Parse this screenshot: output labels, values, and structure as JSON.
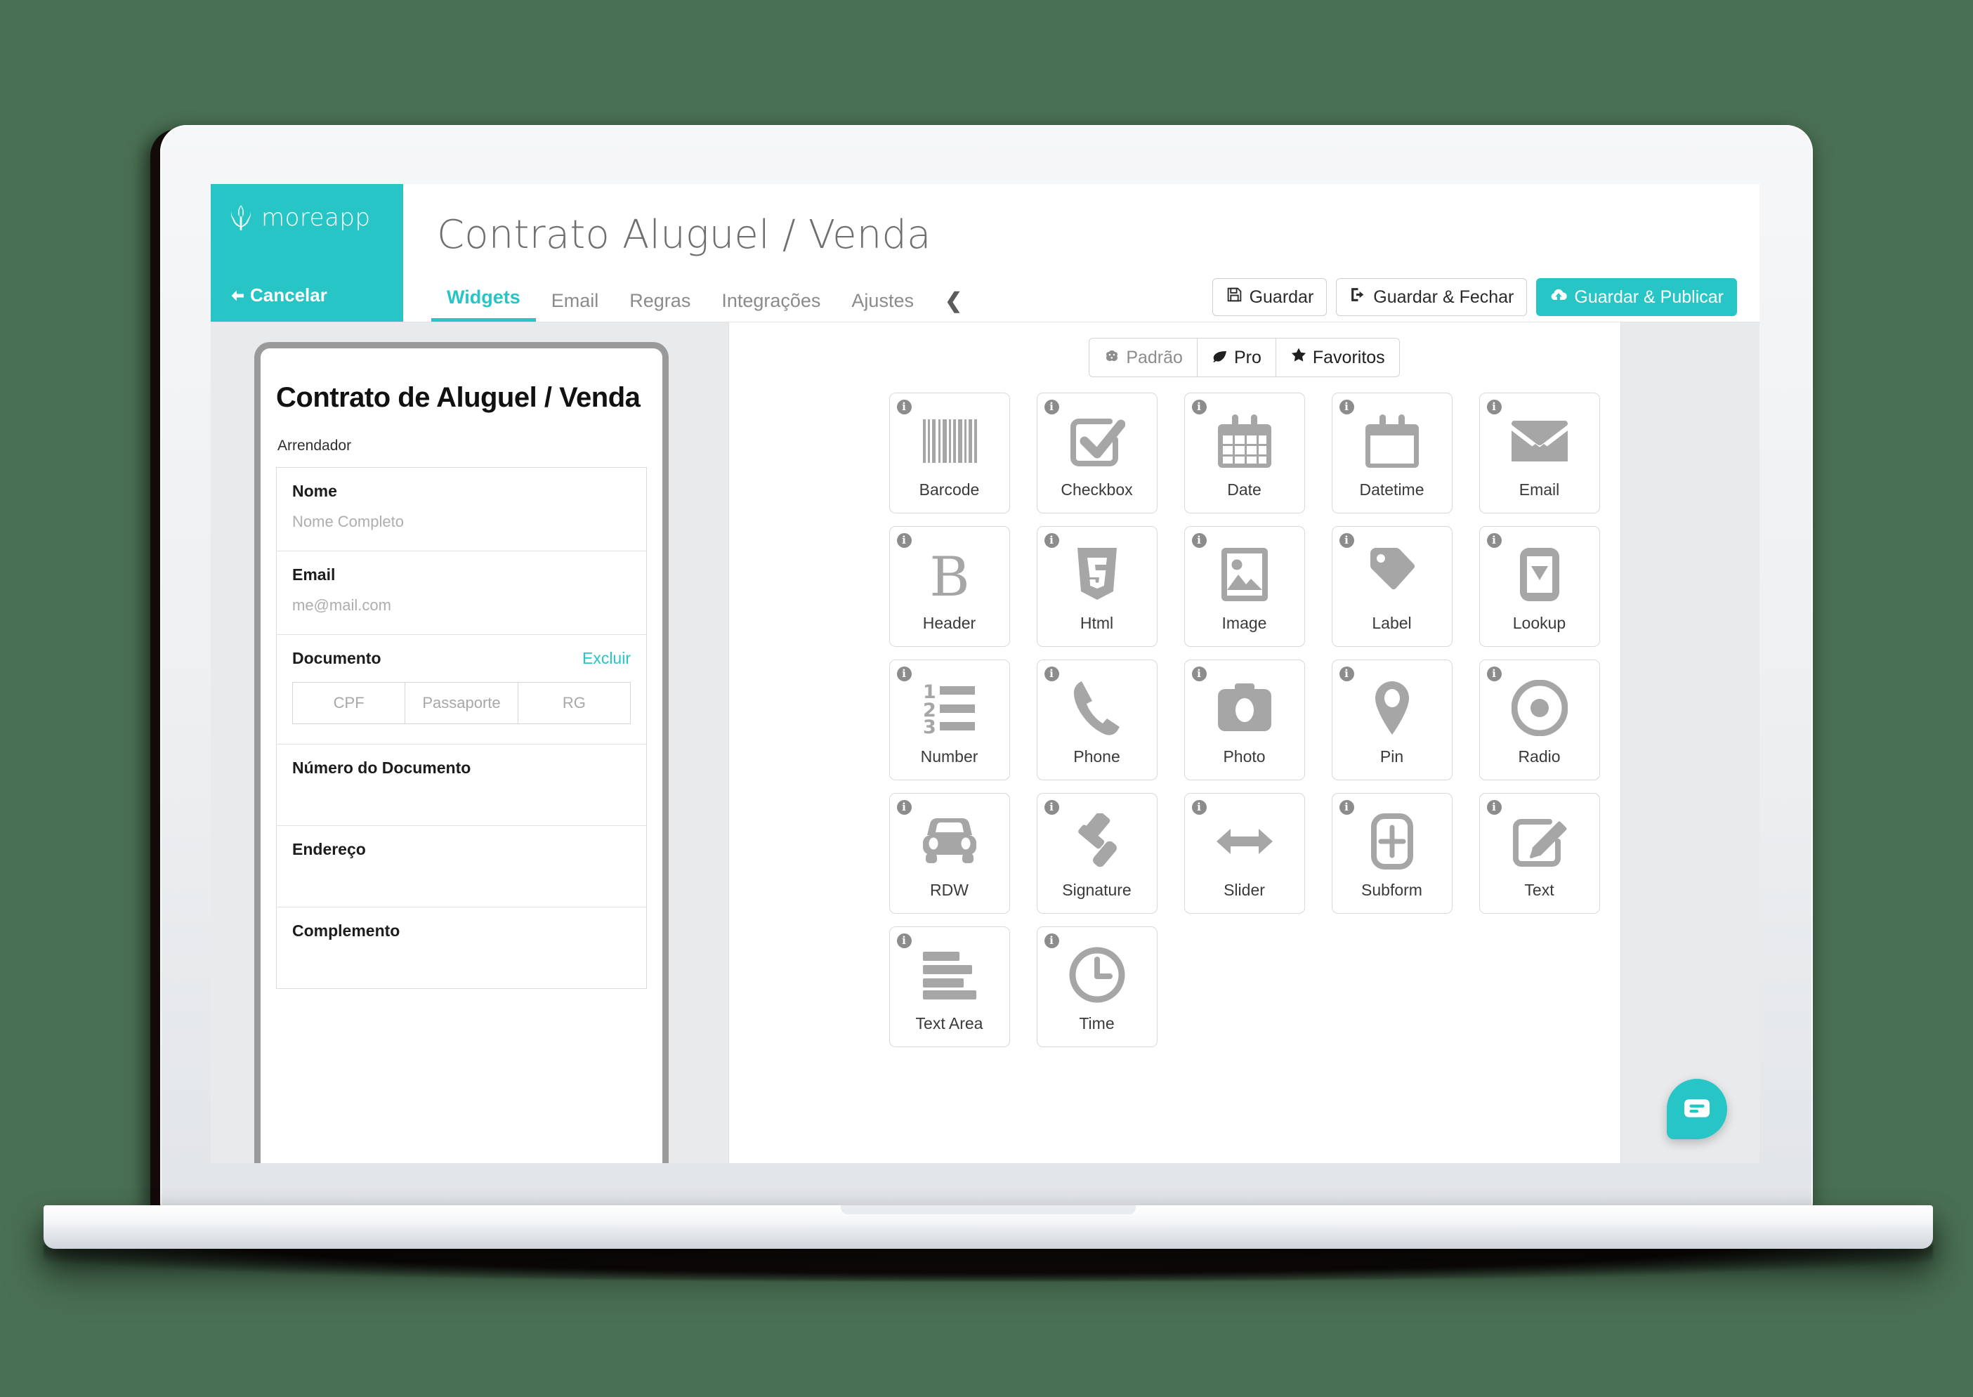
{
  "app": {
    "brand_name": "moreapp",
    "brand_icon": "leaf-logo-icon",
    "cancel_label": "Cancelar",
    "page_title": "Contrato Aluguel / Venda",
    "accent_color": "#27c5c6"
  },
  "tabs": [
    {
      "label": "Widgets",
      "active": true
    },
    {
      "label": "Email",
      "active": false
    },
    {
      "label": "Regras",
      "active": false
    },
    {
      "label": "Integrações",
      "active": false
    },
    {
      "label": "Ajustes",
      "active": false
    }
  ],
  "tab_collapse_icon": "chevron-left-icon",
  "actions": [
    {
      "label": "Guardar",
      "icon": "floppy-save-icon",
      "primary": false
    },
    {
      "label": "Guardar & Fechar",
      "icon": "sign-out-icon",
      "primary": false
    },
    {
      "label": "Guardar & Publicar",
      "icon": "cloud-upload-icon",
      "primary": true
    }
  ],
  "preview": {
    "form_title": "Contrato de Aluguel / Venda",
    "section_label": "Arrendador",
    "fields": [
      {
        "label": "Nome",
        "placeholder": "Nome Completo",
        "type": "text"
      },
      {
        "label": "Email",
        "placeholder": "me@mail.com",
        "type": "email"
      },
      {
        "label": "Documento",
        "type": "radio",
        "delete_label": "Excluir",
        "options": [
          "CPF",
          "Passaporte",
          "RG"
        ]
      },
      {
        "label": "Número do Documento",
        "placeholder": "",
        "type": "text"
      },
      {
        "label": "Endereço",
        "placeholder": "",
        "type": "text"
      },
      {
        "label": "Complemento",
        "placeholder": "",
        "type": "text"
      }
    ]
  },
  "widget_filters": [
    {
      "label": "Padrão",
      "icon": "brain-icon",
      "active": false
    },
    {
      "label": "Pro",
      "icon": "leaf-icon",
      "active": true
    },
    {
      "label": "Favoritos",
      "icon": "star-icon",
      "active": true
    }
  ],
  "widgets": [
    {
      "label": "Barcode",
      "icon": "barcode-icon"
    },
    {
      "label": "Checkbox",
      "icon": "checkbox-icon"
    },
    {
      "label": "Date",
      "icon": "calendar-grid-icon"
    },
    {
      "label": "Datetime",
      "icon": "calendar-blank-icon"
    },
    {
      "label": "Email",
      "icon": "envelope-icon"
    },
    {
      "label": "Header",
      "icon": "bold-b-icon"
    },
    {
      "label": "Html",
      "icon": "html5-shield-icon"
    },
    {
      "label": "Image",
      "icon": "picture-icon"
    },
    {
      "label": "Label",
      "icon": "tag-icon"
    },
    {
      "label": "Lookup",
      "icon": "dropdown-box-icon"
    },
    {
      "label": "Number",
      "icon": "numbered-list-icon"
    },
    {
      "label": "Phone",
      "icon": "phone-icon"
    },
    {
      "label": "Photo",
      "icon": "camera-icon"
    },
    {
      "label": "Pin",
      "icon": "map-pin-icon"
    },
    {
      "label": "Radio",
      "icon": "radio-circle-icon"
    },
    {
      "label": "RDW",
      "icon": "car-icon"
    },
    {
      "label": "Signature",
      "icon": "gavel-icon"
    },
    {
      "label": "Slider",
      "icon": "arrows-horizontal-icon"
    },
    {
      "label": "Subform",
      "icon": "plus-box-icon"
    },
    {
      "label": "Text",
      "icon": "pencil-square-icon"
    },
    {
      "label": "Text Area",
      "icon": "text-lines-icon"
    },
    {
      "label": "Time",
      "icon": "clock-icon"
    }
  ],
  "chat": {
    "icon": "chat-bubble-icon"
  },
  "info_badge_glyph": "i"
}
